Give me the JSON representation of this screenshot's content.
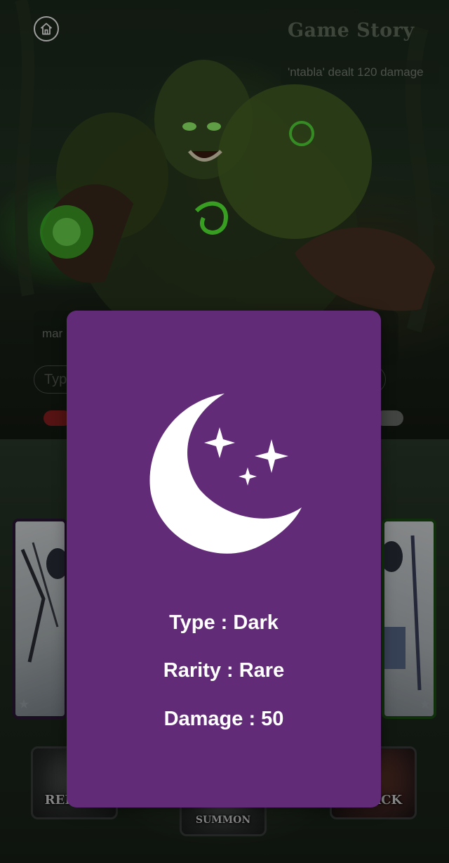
{
  "header": {
    "home_icon": "home-icon",
    "title": "Game Story",
    "battle_log": "'ntabla' dealt 120 damage"
  },
  "chat": {
    "message_fragment": "mar",
    "input_placeholder": "Typ"
  },
  "actions": {
    "reroll_label": "REROLL",
    "summon_label": "SUMMON",
    "attack_label": "ATTACK"
  },
  "card_modal": {
    "icon": "crescent-moon-stars-icon",
    "background_color": "#622b78",
    "type_line": "Type : Dark",
    "rarity_line": "Rarity : Rare",
    "damage_line": "Damage : 50"
  }
}
